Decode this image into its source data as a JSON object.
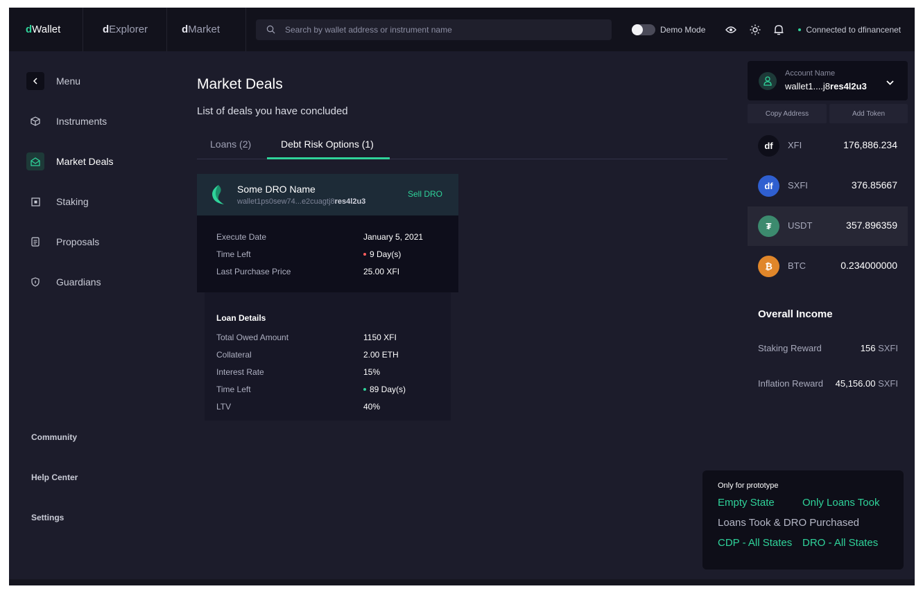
{
  "colors": {
    "accent": "#2fd39a",
    "danger": "#ff5d5d",
    "bg": "#1c1c2b",
    "topbar": "#12121c"
  },
  "topbar": {
    "wallet_prefix": "d",
    "wallet_name": "Wallet",
    "explorer_prefix": "d",
    "explorer_name": "Explorer",
    "market_prefix": "d",
    "market_name": "Market",
    "search_placeholder": "Search by wallet address or instrument name",
    "demo_mode_label": "Demo Mode",
    "demo_mode_on": false,
    "connection_text": "Connected to dfinancenet"
  },
  "sidebar": {
    "menu_label": "Menu",
    "items": [
      {
        "label": "Instruments",
        "icon": "cube-icon",
        "active": false
      },
      {
        "label": "Market Deals",
        "icon": "handshake-icon",
        "active": true
      },
      {
        "label": "Staking",
        "icon": "staking-icon",
        "active": false
      },
      {
        "label": "Proposals",
        "icon": "document-icon",
        "active": false
      },
      {
        "label": "Guardians",
        "icon": "shield-icon",
        "active": false
      }
    ],
    "footer": [
      "Community",
      "Help Center",
      "Settings"
    ]
  },
  "main": {
    "title": "Market Deals",
    "subtitle": "List of deals you have concluded",
    "tabs": [
      {
        "label": "Loans (2)",
        "active": false
      },
      {
        "label": "Debt Risk Options (1)",
        "active": true
      }
    ],
    "dro": {
      "name": "Some DRO Name",
      "address_prefix": "wallet1ps0sew74...e2cuagtj8",
      "address_suffix": "res4l2u3",
      "action_label": "Sell DRO",
      "details": [
        {
          "label": "Execute Date",
          "value": "January 5, 2021",
          "dot": null
        },
        {
          "label": "Time Left",
          "value": "9 Day(s)",
          "dot": "red"
        },
        {
          "label": "Last Purchase Price",
          "value": "25.00 XFI",
          "dot": null
        }
      ]
    },
    "loan": {
      "heading": "Loan Details",
      "details": [
        {
          "label": "Total Owed Amount",
          "value": "1150 XFI",
          "dot": null
        },
        {
          "label": "Collateral",
          "value": "2.00 ETH",
          "dot": null
        },
        {
          "label": "Interest Rate",
          "value": "15%",
          "dot": null
        },
        {
          "label": "Time Left",
          "value": "89 Day(s)",
          "dot": "green"
        },
        {
          "label": "LTV",
          "value": "40%",
          "dot": null
        }
      ]
    }
  },
  "account": {
    "label": "Account Name",
    "address_prefix": "wallet1....j8",
    "address_suffix": "res4l2u3",
    "copy_label": "Copy Address",
    "add_token_label": "Add Token"
  },
  "tokens": [
    {
      "symbol": "XFI",
      "value": "176,886.234",
      "icon_text": "df",
      "icon_bg": "#0e0e19",
      "icon_name": "xfi-token-icon",
      "highlight": false
    },
    {
      "symbol": "SXFI",
      "value": "376.85667",
      "icon_text": "df",
      "icon_bg": "#2f5fd0",
      "icon_name": "sxfi-token-icon",
      "highlight": false
    },
    {
      "symbol": "USDT",
      "value": "357.896359",
      "icon_text": "₮",
      "icon_bg": "#3c8a6e",
      "icon_name": "usdt-token-icon",
      "highlight": true
    },
    {
      "symbol": "BTC",
      "value": "0.234000000",
      "icon_text": "₿",
      "icon_bg": "#e0862a",
      "icon_name": "btc-token-icon",
      "highlight": false
    }
  ],
  "income": {
    "title": "Overall Income",
    "rows": [
      {
        "label": "Staking Reward",
        "value": "156",
        "unit": "SXFI"
      },
      {
        "label": "Inflation Reward",
        "value": "45,156.00",
        "unit": "SXFI"
      }
    ]
  },
  "prototype": {
    "title": "Only for prototype",
    "links": [
      {
        "label": "Empty State",
        "style": "green"
      },
      {
        "label": "Only Loans Took",
        "style": "green"
      },
      {
        "label": "Loans Took & DRO Purchased",
        "style": "grey"
      },
      {
        "label": "CDP - All States",
        "style": "green"
      },
      {
        "label": "DRO - All States",
        "style": "green"
      }
    ]
  }
}
